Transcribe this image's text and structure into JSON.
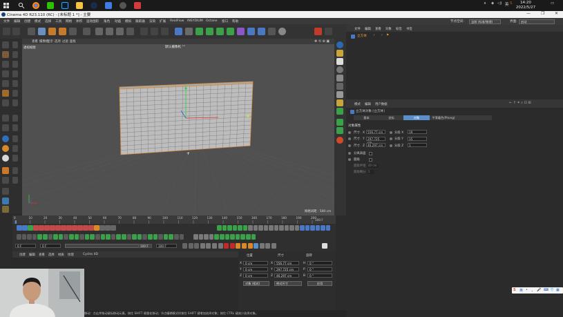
{
  "taskbar": {
    "clock_time": "14:20",
    "clock_date": "2022/5/27",
    "tray_lang": "英",
    "tray_up": "∧"
  },
  "window": {
    "title": "Cinema 4D R23.110 (RC) - [未标题 1 *] - 主要",
    "min": "—",
    "max": "❐",
    "close": "✕"
  },
  "menubar": {
    "items": [
      "文件",
      "编辑",
      "创建",
      "模式",
      "选择",
      "工具",
      "网格",
      "体积",
      "运动图形",
      "角色",
      "动画",
      "模拟",
      "跟踪器",
      "渲染",
      "扩展",
      "RealFlow",
      "INSYDIUM",
      "Octane",
      "窗口",
      "帮助"
    ],
    "right_label1": "节点空间:",
    "right_value1": "当前 (标准/物理)",
    "right_label2": "界面:",
    "right_value2": "启动"
  },
  "viewport": {
    "menu": [
      "查看",
      "摄像机",
      "显示",
      "选项",
      "过滤",
      "面板"
    ],
    "view_name": "透视视图",
    "camera": "默认摄像机 °°",
    "grid_spacing": "网格间距 : 500 cm"
  },
  "timeline": {
    "ticks": [
      "0",
      "10",
      "20",
      "30",
      "40",
      "50",
      "60",
      "70",
      "80",
      "90",
      "100",
      "110",
      "120",
      "130",
      "140",
      "150",
      "160",
      "170",
      "180",
      "190",
      "200"
    ],
    "end_frame": "100 F",
    "start_field": "0 F",
    "start_field2": "0 F",
    "end_field1": "100 F",
    "end_field2": "100 F"
  },
  "material_panel": {
    "menu": [
      "创建",
      "编辑",
      "查看",
      "选择",
      "材质",
      "纹理",
      "Cycles 4D"
    ]
  },
  "coord_panel": {
    "header_pos": "位置",
    "header_size": "尺寸",
    "header_rot": "旋转",
    "rows": [
      {
        "axis": "X",
        "pos": "0 cm",
        "size": "556.77 cm",
        "rot_axis": "H",
        "rot": "0 °"
      },
      {
        "axis": "Y",
        "pos": "0 cm",
        "size": "297.725 cm",
        "rot_axis": "P",
        "rot": "0 °"
      },
      {
        "axis": "Z",
        "pos": "0 cm",
        "size": "46.297 cm",
        "rot_axis": "B",
        "rot": "0 °"
      }
    ],
    "mode_dropdown": "对象 (相对)",
    "size_dropdown": "绝对尺寸",
    "apply_button": "应用"
  },
  "object_manager": {
    "menu": [
      "文件",
      "编辑",
      "查看",
      "对象",
      "标签",
      "书签"
    ],
    "object_name": "立方体"
  },
  "attribute_manager": {
    "menu": [
      "模式",
      "编辑",
      "用户数据"
    ],
    "object_title": "立方体对象 [立方体]",
    "tabs": [
      "基本",
      "坐标",
      "对象",
      "平滑着色(Phong)"
    ],
    "active_tab": 2,
    "section": "对象属性",
    "size_rows": [
      {
        "label": "尺寸 . X",
        "value": "556.77 cm",
        "seg_label": "分段 X",
        "seg": "19"
      },
      {
        "label": "尺寸 . Y",
        "value": "297.725 cm",
        "seg_label": "分段 Y",
        "seg": "15"
      },
      {
        "label": "尺寸 . Z",
        "value": "46.297 cm",
        "seg_label": "分段 Z",
        "seg": "1"
      }
    ],
    "separate_surfaces": "分离表面",
    "fillet": "圆角",
    "fillet_radius": "圆角半径",
    "fillet_radius_value": "40 cm",
    "fillet_subdivision": "圆角细分",
    "fillet_subdivision_value": "5"
  },
  "statusbar": {
    "text": "移动：点击并拖动鼠标移动元素。按住 SHIFT 键量化移动；节点编辑模式时按住 SHIFT 键增加选择对象；按住 CTRL 键减少选择对象。"
  },
  "ime": {
    "s": "S",
    "lang": "英",
    "items": [
      "•",
      "，",
      "🎤",
      "⌨",
      "👕",
      "▦"
    ]
  },
  "colors": {
    "accent_blue": "#5a8fc8",
    "viewport_bg": "#505050",
    "mesh_face": "#bdbdbd",
    "mesh_edge": "#6a6a6a",
    "selected_outline": "#d88a3a"
  }
}
